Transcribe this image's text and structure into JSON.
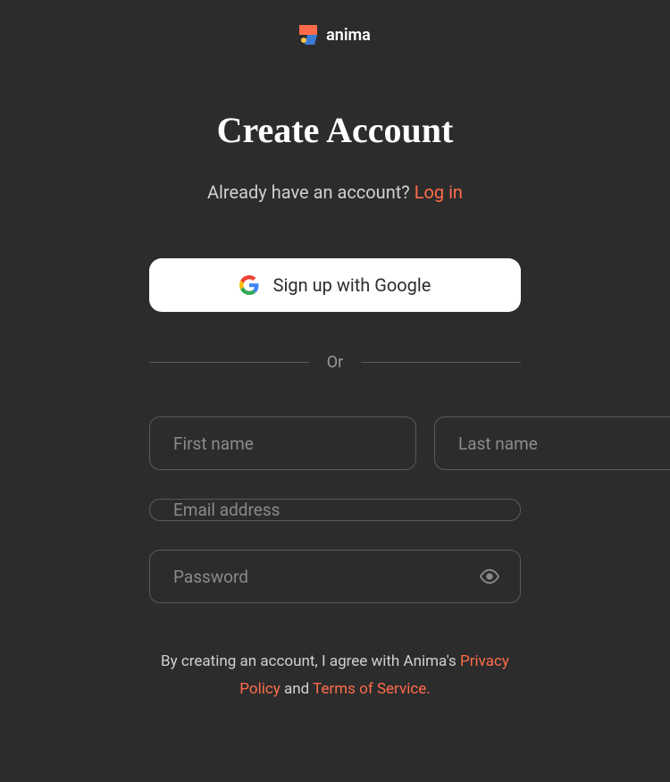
{
  "brand": {
    "name": "anima"
  },
  "header": {
    "title": "Create Account",
    "login_prompt": "Already have an account? ",
    "login_link": "Log in"
  },
  "oauth": {
    "google_label": "Sign up with Google"
  },
  "divider": {
    "text": "Or"
  },
  "form": {
    "first_name_placeholder": "First name",
    "last_name_placeholder": "Last name",
    "email_placeholder": "Email address",
    "password_placeholder": "Password"
  },
  "terms": {
    "prefix": "By creating an account, I agree with Anima's ",
    "privacy_link": "Privacy Policy",
    "conjunction": " and ",
    "tos_link": "Terms of Service."
  },
  "colors": {
    "background": "#2c2c2c",
    "accent": "#ff6b4a",
    "input_border": "#5a5a5a",
    "placeholder": "#8a8a8a"
  }
}
